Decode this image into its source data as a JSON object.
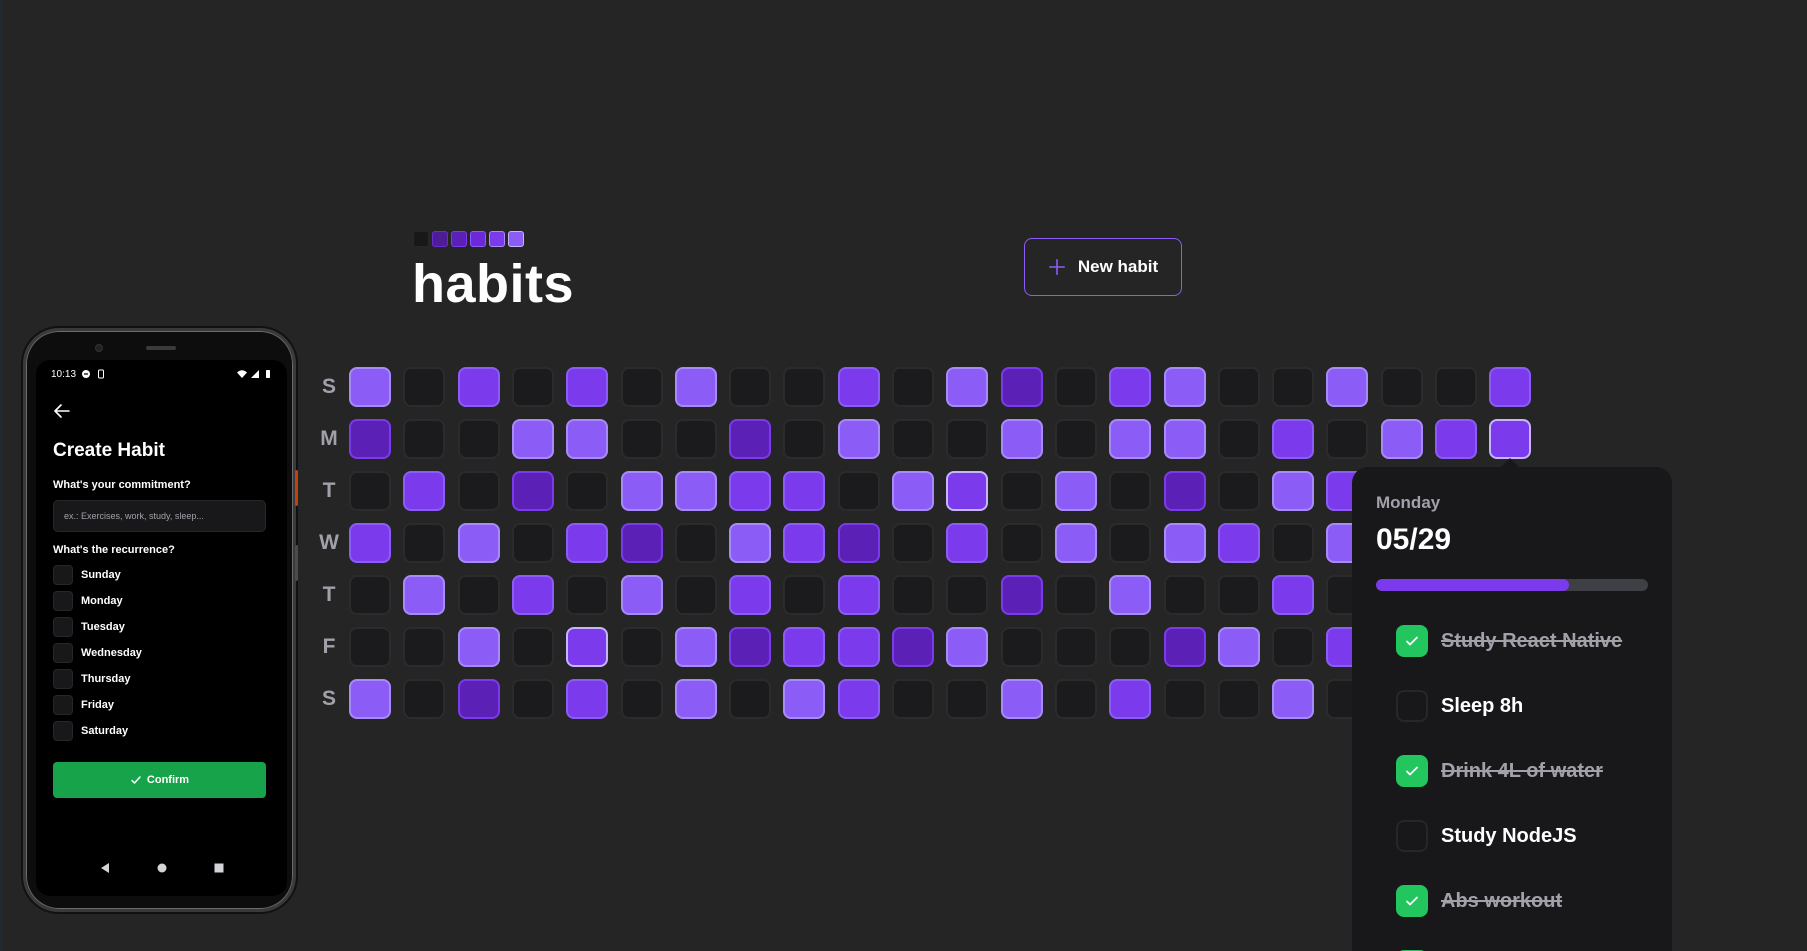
{
  "app": {
    "title": "habits",
    "new_habit_label": "New habit",
    "logo_colors": [
      {
        "bg": "#18181b",
        "border": "#27272a"
      },
      {
        "bg": "#4c1d95",
        "border": "#6d28d9"
      },
      {
        "bg": "#5b21b6",
        "border": "#7c3aed"
      },
      {
        "bg": "#6d28d9",
        "border": "#8b5cf6"
      },
      {
        "bg": "#7c3aed",
        "border": "#a78bfa"
      },
      {
        "bg": "#8b5cf6",
        "border": "#c4b5fd"
      }
    ],
    "accent": "#8b5cf6"
  },
  "weekdays": [
    "S",
    "M",
    "T",
    "W",
    "T",
    "F",
    "S"
  ],
  "heatmap": {
    "columns_visible": 22,
    "rows": [
      [
        4,
        0,
        3,
        0,
        3,
        0,
        4,
        0,
        0,
        3,
        0,
        4,
        1,
        0,
        3,
        4,
        0,
        0,
        4,
        0,
        0,
        3
      ],
      [
        1,
        0,
        0,
        4,
        4,
        0,
        0,
        1,
        0,
        4,
        0,
        0,
        4,
        0,
        4,
        4,
        0,
        3,
        0,
        4,
        3,
        5
      ],
      [
        0,
        3,
        0,
        1,
        0,
        4,
        4,
        3,
        3,
        0,
        4,
        5,
        0,
        4,
        0,
        1,
        0,
        4,
        3
      ],
      [
        3,
        0,
        4,
        0,
        3,
        1,
        0,
        4,
        3,
        1,
        0,
        3,
        0,
        4,
        0,
        4,
        3,
        0,
        4
      ],
      [
        0,
        4,
        0,
        3,
        0,
        4,
        0,
        3,
        0,
        3,
        0,
        0,
        1,
        0,
        4,
        0,
        0,
        3,
        0
      ],
      [
        0,
        0,
        4,
        0,
        5,
        0,
        4,
        1,
        3,
        3,
        1,
        4,
        0,
        0,
        0,
        1,
        4,
        0,
        3
      ],
      [
        4,
        0,
        1,
        0,
        3,
        0,
        4,
        0,
        4,
        3,
        0,
        0,
        4,
        0,
        3,
        0,
        0,
        4,
        0
      ]
    ],
    "selected": {
      "row": 1,
      "col": 21
    }
  },
  "popover": {
    "weekday": "Monday",
    "date": "05/29",
    "progress": 0.71,
    "habits": [
      {
        "label": "Study React Native",
        "done": true
      },
      {
        "label": "Sleep 8h",
        "done": false
      },
      {
        "label": "Drink 4L of water",
        "done": true
      },
      {
        "label": "Study NodeJS",
        "done": false
      },
      {
        "label": "Abs workout",
        "done": true
      },
      {
        "label": "",
        "done": true
      }
    ]
  },
  "phone": {
    "status_time": "10:13",
    "title": "Create Habit",
    "commitment_label": "What's your commitment?",
    "commitment_placeholder": "ex.: Exercises, work, study, sleep...",
    "recurrence_label": "What's the recurrence?",
    "days": [
      "Sunday",
      "Monday",
      "Tuesday",
      "Wednesday",
      "Thursday",
      "Friday",
      "Saturday"
    ],
    "confirm_label": "Confirm",
    "confirm_color": "#16a34a"
  }
}
